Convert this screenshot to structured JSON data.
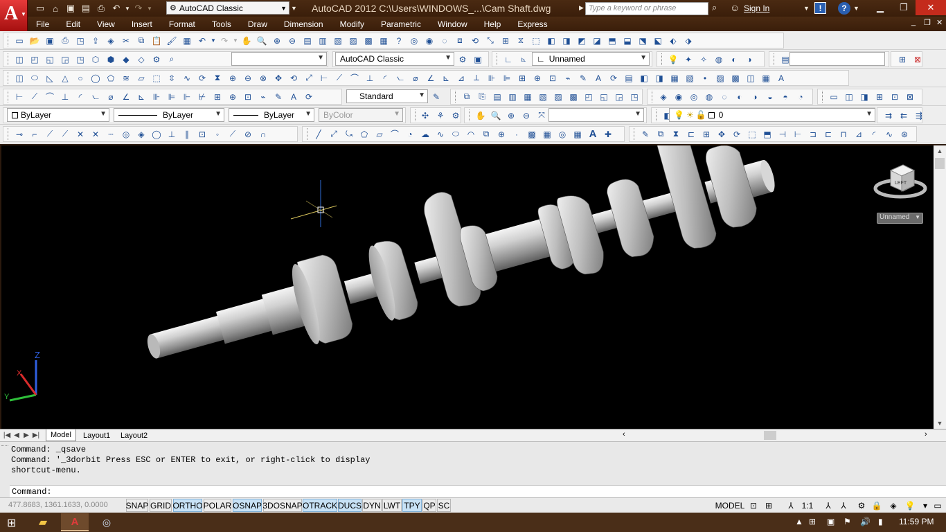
{
  "titlebar": {
    "workspace": "AutoCAD Classic",
    "title": "AutoCAD 2012    C:\\Users\\WINDOWS_...\\Cam Shaft.dwg",
    "search_placeholder": "Type a keyword or phrase",
    "signin": "Sign In"
  },
  "menu": [
    "File",
    "Edit",
    "View",
    "Insert",
    "Format",
    "Tools",
    "Draw",
    "Dimension",
    "Modify",
    "Parametric",
    "Window",
    "Help",
    "Express"
  ],
  "toolbars": {
    "workspace_combo": "AutoCAD Classic",
    "view_combo": "Unnamed",
    "textstyle_combo": "Standard",
    "color_combo": "ByLayer",
    "linetype_combo": "ByLayer",
    "lineweight_combo": "ByLayer",
    "plotstyle_combo": "ByColor",
    "layer_combo": "0"
  },
  "viewport": {
    "viewcube_face": "LEFT",
    "viewcube_label": "Unnamed",
    "ucs": {
      "z": "Z",
      "x": "X",
      "y": "Y"
    }
  },
  "layout_tabs": [
    "Model",
    "Layout1",
    "Layout2"
  ],
  "command": {
    "history": [
      "Command: _qsave",
      "Command: '_3dorbit Press ESC or ENTER to exit, or right-click to display",
      "shortcut-menu."
    ],
    "prompt": "Command:"
  },
  "status": {
    "coords": "477.8683, 1361.1633, 0.0000",
    "toggles": [
      {
        "label": "SNAP",
        "on": false
      },
      {
        "label": "GRID",
        "on": false
      },
      {
        "label": "ORTHO",
        "on": true
      },
      {
        "label": "POLAR",
        "on": false
      },
      {
        "label": "OSNAP",
        "on": true
      },
      {
        "label": "3DOSNAP",
        "on": false
      },
      {
        "label": "OTRACK",
        "on": true
      },
      {
        "label": "DUCS",
        "on": true
      },
      {
        "label": "DYN",
        "on": false
      },
      {
        "label": "LWT",
        "on": false
      },
      {
        "label": "TPY",
        "on": true
      },
      {
        "label": "QP",
        "on": false
      },
      {
        "label": "SC",
        "on": false
      }
    ],
    "space": "MODEL",
    "scale": "1:1"
  },
  "taskbar": {
    "clock": "11:59 PM"
  }
}
